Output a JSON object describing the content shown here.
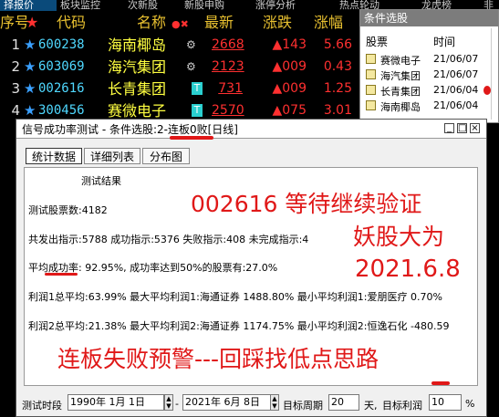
{
  "top_tabs": [
    "择报价",
    "板块监控",
    "次新股",
    "新股申购",
    "涨停分析",
    "热点轮动",
    "龙虎榜",
    "非"
  ],
  "stock_header": {
    "index": "序号",
    "code": "代码",
    "name": "名称",
    "price": "最新",
    "change": "涨跌",
    "pct": "涨幅"
  },
  "stocks": [
    {
      "index": "1",
      "code": "600238",
      "name": "海南椰岛",
      "price": "2668",
      "change": "▲143",
      "pct": "5.66",
      "flag": ""
    },
    {
      "index": "2",
      "code": "603069",
      "name": "海汽集团",
      "price": "2123",
      "change": "▲009",
      "pct": "0.43",
      "flag": ""
    },
    {
      "index": "3",
      "code": "002616",
      "name": "长青集团",
      "price": "731",
      "change": "▲009",
      "pct": "1.25",
      "flag": "T"
    },
    {
      "index": "4",
      "code": "300456",
      "name": "赛微电子",
      "price": "2570",
      "change": "▲075",
      "pct": "3.01",
      "flag": "T"
    }
  ],
  "cond_panel": {
    "title": "条件选股",
    "col_stock": "股票",
    "col_time": "时间",
    "rows": [
      {
        "name": "赛微电子",
        "date": "21/06/07"
      },
      {
        "name": "海汽集团",
        "date": "21/06/07"
      },
      {
        "name": "长青集团",
        "date": "21/06/04"
      },
      {
        "name": "海南椰岛",
        "date": "21/06/04"
      }
    ]
  },
  "dialog": {
    "title": "信号成功率测试 - 条件选股:2-连板0败[日线]",
    "tabs": [
      "统计数据",
      "详细列表",
      "分布图"
    ],
    "result_title": "测试结果",
    "lines": [
      "测试股票数:4182",
      "共发出指示:5788 成功指示:5376 失败指示:408 未完成指示:4",
      "平均成功率: 92.95%, 成功率达到50%的股票有:27.0%",
      "利润1总平均:63.99% 最大平均利润1:海通证券 1488.80% 最小平均利润1:爱朋医疗 0.70%",
      "利润2总平均:21.38% 最大平均利润2:海通证券 1174.75% 最小平均利润2:恒逸石化 -480.59"
    ],
    "annotations": {
      "a1": "002616 等待继续验证",
      "a2": "妖股大为",
      "a3": "2021.6.8",
      "a4": "连板失败预警---回踩找低点思路"
    },
    "bottom": {
      "label_period": "测试时段",
      "start_date": "1990年 1月 1日",
      "dash": "-",
      "end_date": "2021年 6月 8日",
      "label_target": "目标周期",
      "target_days": "20",
      "label_days": "天,",
      "label_profit": "目标利润",
      "target_profit": "10",
      "pct": "%"
    }
  },
  "colors": {
    "accent_red": "#e01818",
    "name_yellow": "#ffff40",
    "code_cyan": "#4fd8ff"
  }
}
